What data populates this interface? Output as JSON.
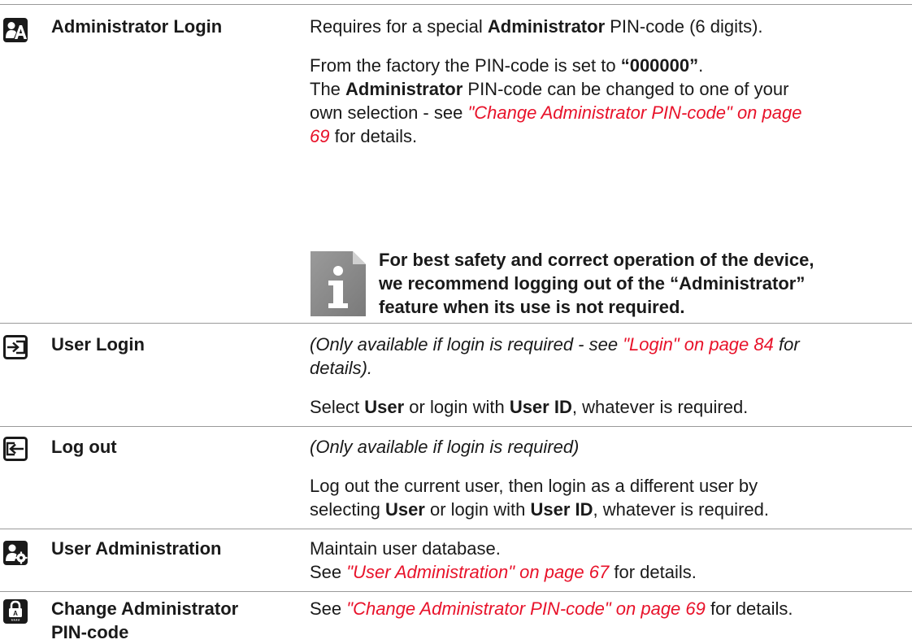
{
  "rows": {
    "admin_login": {
      "term": "Administrator Login",
      "line1": {
        "a": "Requires for a special ",
        "b": "Administrator",
        "c": " PIN-code (6 digits)."
      },
      "line2": {
        "a": "From the factory the PIN-code is set to ",
        "b": "“000000”",
        "c": "."
      },
      "line3": {
        "a": "The ",
        "b": "Administrator",
        "c": " PIN-code can be changed to one of your"
      },
      "line4": {
        "a": "own selection - see ",
        "link": "\"Change Administrator PIN-code\" on page"
      },
      "line5": {
        "link": "69",
        "c": " for details."
      },
      "note": [
        "For best safety and correct operation of the device,",
        "we recommend logging out of the “Administrator”",
        "feature when its use is not required."
      ]
    },
    "user_login": {
      "term": "User Login",
      "line1": {
        "a": "(Only available if login is required - see ",
        "link": "\"Login\" on page 84",
        "c": " for"
      },
      "line2": "details).",
      "line3": {
        "a": "Select ",
        "b": "User",
        "c": " or login with ",
        "d": "User ID",
        "e": ", whatever is required."
      }
    },
    "log_out": {
      "term": "Log out",
      "line1": "(Only available if login is required)",
      "line2": "Log out the current user, then login as a different user by",
      "line3": {
        "a": "selecting ",
        "b": "User",
        "c": " or login with ",
        "d": "User ID",
        "e": ", whatever is required."
      }
    },
    "user_admin": {
      "term": "User Administration",
      "line1": "Maintain user database.",
      "line2": {
        "a": "See ",
        "link": "\"User Administration\" on page 67",
        "c": " for details."
      }
    },
    "change_pin": {
      "term_line1": "Change Administrator",
      "term_line2": "PIN-code",
      "line1": {
        "a": "See ",
        "link": "\"Change Administrator PIN-code\" on page 69",
        "c": " for details."
      }
    }
  },
  "icons": [
    "admin-login-icon",
    "user-login-icon",
    "log-out-icon",
    "user-administration-icon",
    "change-pin-icon",
    "info-note-icon"
  ],
  "colors": {
    "link": "#e8122a",
    "rule": "#9a9a9a",
    "icon": "#1a1a1a",
    "note_icon": "#8a8a8a"
  }
}
